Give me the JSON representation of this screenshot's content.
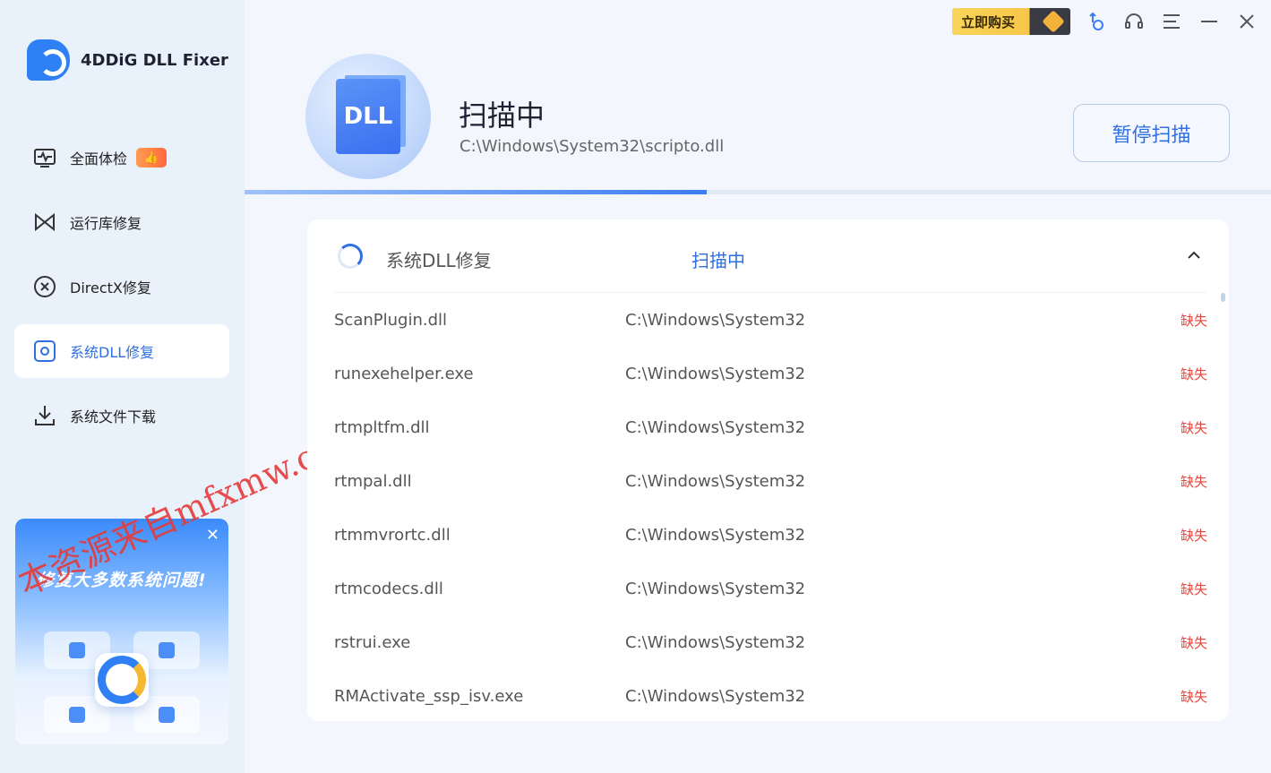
{
  "app": {
    "name": "4DDiG DLL Fixer"
  },
  "topbar": {
    "buy_label": "立即购买"
  },
  "sidebar": {
    "items": [
      {
        "label": "全面体检",
        "icon": "health-check-icon"
      },
      {
        "label": "运行库修复",
        "icon": "runtime-repair-icon"
      },
      {
        "label": "DirectX修复",
        "icon": "directx-icon"
      },
      {
        "label": "系统DLL修复",
        "icon": "dll-repair-icon",
        "active": true
      },
      {
        "label": "系统文件下载",
        "icon": "download-icon"
      }
    ],
    "promo": {
      "title": "修复大多数系统问题!"
    }
  },
  "watermark": {
    "text": "本资源来自mfxmw.com"
  },
  "header": {
    "hero_text": "DLL",
    "title": "扫描中",
    "path": "C:\\Windows\\System32\\scripto.dll",
    "pause_label": "暂停扫描",
    "progress": 0.45
  },
  "panel": {
    "title": "系统DLL修复",
    "status": "扫描中",
    "rows": [
      {
        "name": "ScanPlugin.dll",
        "path": "C:\\Windows\\System32",
        "status": "缺失"
      },
      {
        "name": "runexehelper.exe",
        "path": "C:\\Windows\\System32",
        "status": "缺失"
      },
      {
        "name": "rtmpltfm.dll",
        "path": "C:\\Windows\\System32",
        "status": "缺失"
      },
      {
        "name": "rtmpal.dll",
        "path": "C:\\Windows\\System32",
        "status": "缺失"
      },
      {
        "name": "rtmmvrortc.dll",
        "path": "C:\\Windows\\System32",
        "status": "缺失"
      },
      {
        "name": "rtmcodecs.dll",
        "path": "C:\\Windows\\System32",
        "status": "缺失"
      },
      {
        "name": "rstrui.exe",
        "path": "C:\\Windows\\System32",
        "status": "缺失"
      },
      {
        "name": "RMActivate_ssp_isv.exe",
        "path": "C:\\Windows\\System32",
        "status": "缺失"
      }
    ]
  }
}
